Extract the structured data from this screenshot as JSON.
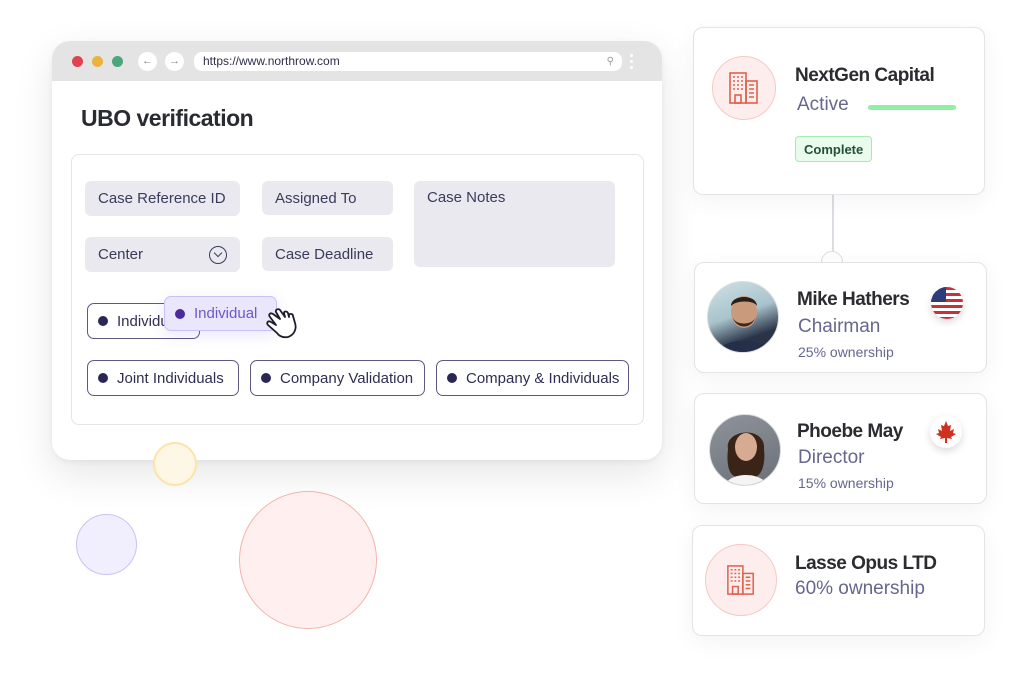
{
  "browser": {
    "url": "https://www.northrow.com",
    "icons": {
      "back": "arrow-left-icon",
      "forward": "arrow-right-icon",
      "search": "search-icon",
      "menu": "kebab-menu-icon"
    }
  },
  "form": {
    "title": "UBO verification",
    "fields": {
      "case_reference_id": "Case Reference ID",
      "assigned_to": "Assigned To",
      "case_notes": "Case Notes",
      "center": "Center",
      "case_deadline": "Case Deadline"
    },
    "case_types": [
      "Individual",
      "Joint Individuals",
      "Company Validation",
      "Company & Individuals"
    ],
    "dragging_chip": "Individual"
  },
  "entities": {
    "company": {
      "name": "NextGen Capital",
      "status": "Active",
      "status_color": "#8ff0a4",
      "badge": "Complete"
    },
    "people": [
      {
        "name": "Mike Hathers",
        "role": "Chairman",
        "ownership": "25% ownership",
        "flag": "us-flag-icon"
      },
      {
        "name": "Phoebe May",
        "role": "Director",
        "ownership": "15% ownership",
        "flag": "canada-flag-icon"
      }
    ],
    "subsidiary": {
      "name": "Lasse Opus LTD",
      "ownership": "60% ownership"
    }
  },
  "colors": {
    "accent_purple": "#6f57c9",
    "chip_border": "#5d5a82",
    "company_icon": "#e0604c",
    "success": "#8ff0a4"
  }
}
